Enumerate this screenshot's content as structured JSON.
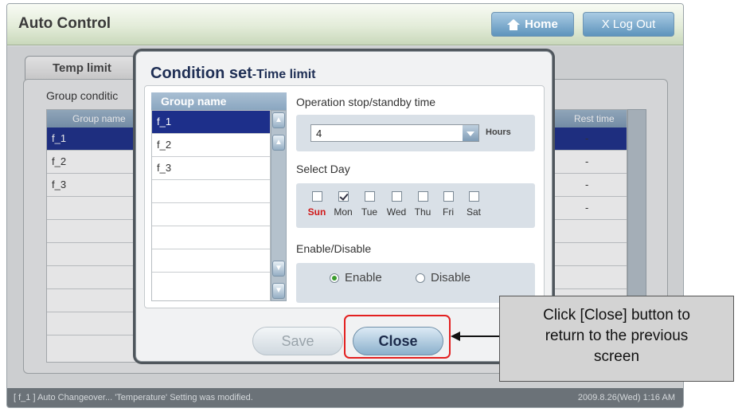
{
  "app": {
    "title": "Auto Control",
    "home_label": "Home",
    "logout_label": "X Log Out"
  },
  "background": {
    "tab_label": "Temp limit",
    "group_condition_label": "Group conditic",
    "col_group_name": "Group name",
    "col_rest_time": "Rest time",
    "rows": [
      {
        "name": "f_1",
        "rest": "-"
      },
      {
        "name": "f_2",
        "rest": "-"
      },
      {
        "name": "f_3",
        "rest": "-"
      },
      {
        "name": "",
        "rest": "-"
      }
    ]
  },
  "status": {
    "message": "[ f_1 ] Auto Changeover... 'Temperature' Setting was modified.",
    "datetime": "2009.8.26(Wed) 1:16 AM"
  },
  "modal": {
    "title": "Condition set",
    "subtitle": "-Time limit",
    "list_header": "Group name",
    "groups": [
      "f_1",
      "f_2",
      "f_3",
      "",
      "",
      "",
      "",
      ""
    ],
    "selected_group": "f_1",
    "op_label": "Operation stop/standby time",
    "op_value": "4",
    "op_unit": "Hours",
    "day_label": "Select Day",
    "days": [
      {
        "label": "Sun",
        "checked": false
      },
      {
        "label": "Mon",
        "checked": true
      },
      {
        "label": "Tue",
        "checked": false
      },
      {
        "label": "Wed",
        "checked": false
      },
      {
        "label": "Thu",
        "checked": false
      },
      {
        "label": "Fri",
        "checked": false
      },
      {
        "label": "Sat",
        "checked": false
      }
    ],
    "enable_label": "Enable/Disable",
    "enable_option": "Enable",
    "disable_option": "Disable",
    "enabled": true,
    "save_label": "Save",
    "close_label": "Close"
  },
  "annotation": {
    "line1": "Click [Close] button to",
    "line2": "return to the previous",
    "line3": "screen",
    "highlight_color": "#e32020"
  }
}
